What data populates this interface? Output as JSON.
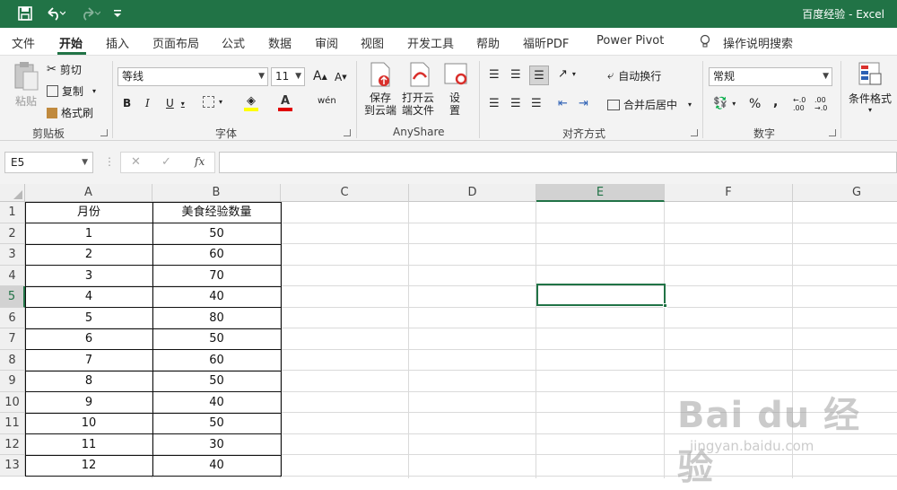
{
  "titlebar": {
    "text": "百度经验 - Excel",
    "save_icon": "save-icon",
    "undo_icon": "undo-icon",
    "redo_icon": "redo-icon",
    "customize_icon": "customize-quick-access-icon"
  },
  "tabs": [
    "文件",
    "开始",
    "插入",
    "页面布局",
    "公式",
    "数据",
    "审阅",
    "视图",
    "开发工具",
    "帮助",
    "福昕PDF",
    "Power Pivot"
  ],
  "active_tab": "开始",
  "tell_me": "操作说明搜索",
  "ribbon": {
    "clipboard": {
      "paste": "粘贴",
      "cut": "剪切",
      "copy": "复制",
      "format_painter": "格式刷",
      "group": "剪贴板"
    },
    "font": {
      "name": "等线",
      "size": "11",
      "bold": "B",
      "italic": "I",
      "underline": "U",
      "group": "字体",
      "grow": "A",
      "shrink": "A",
      "phonetic": "wén"
    },
    "anyshare": {
      "save_cloud": "保存\n到云端",
      "open_cloud": "打开云\n端文件",
      "settings": "设\n置",
      "group": "AnyShare"
    },
    "alignment": {
      "wrap_text": "自动换行",
      "merge_center": "合并后居中",
      "group": "对齐方式"
    },
    "number": {
      "format": "常规",
      "percent": "%",
      "comma": ",",
      "group": "数字",
      "inc_decimal": "←.0\n.00",
      "dec_decimal": ".00\n→.0"
    },
    "styles": {
      "conditional": "条件格式"
    }
  },
  "formula_bar": {
    "name_box": "E5",
    "cancel": "✕",
    "enter": "✓",
    "fx": "fx",
    "value": ""
  },
  "columns": [
    "A",
    "B",
    "C",
    "D",
    "E",
    "F",
    "G"
  ],
  "selected_column": "E",
  "rows": [
    "1",
    "2",
    "3",
    "4",
    "5",
    "6",
    "7",
    "8",
    "9",
    "10",
    "11",
    "12",
    "13"
  ],
  "selected_row": "5",
  "table": {
    "header": [
      "月份",
      "美食经验数量"
    ],
    "data": [
      [
        "1",
        "50"
      ],
      [
        "2",
        "60"
      ],
      [
        "3",
        "70"
      ],
      [
        "4",
        "40"
      ],
      [
        "5",
        "80"
      ],
      [
        "6",
        "50"
      ],
      [
        "7",
        "60"
      ],
      [
        "8",
        "50"
      ],
      [
        "9",
        "40"
      ],
      [
        "10",
        "50"
      ],
      [
        "11",
        "30"
      ],
      [
        "12",
        "40"
      ]
    ]
  },
  "watermark": {
    "main": "Bai du 经验",
    "sub": "jingyan.baidu.com"
  }
}
